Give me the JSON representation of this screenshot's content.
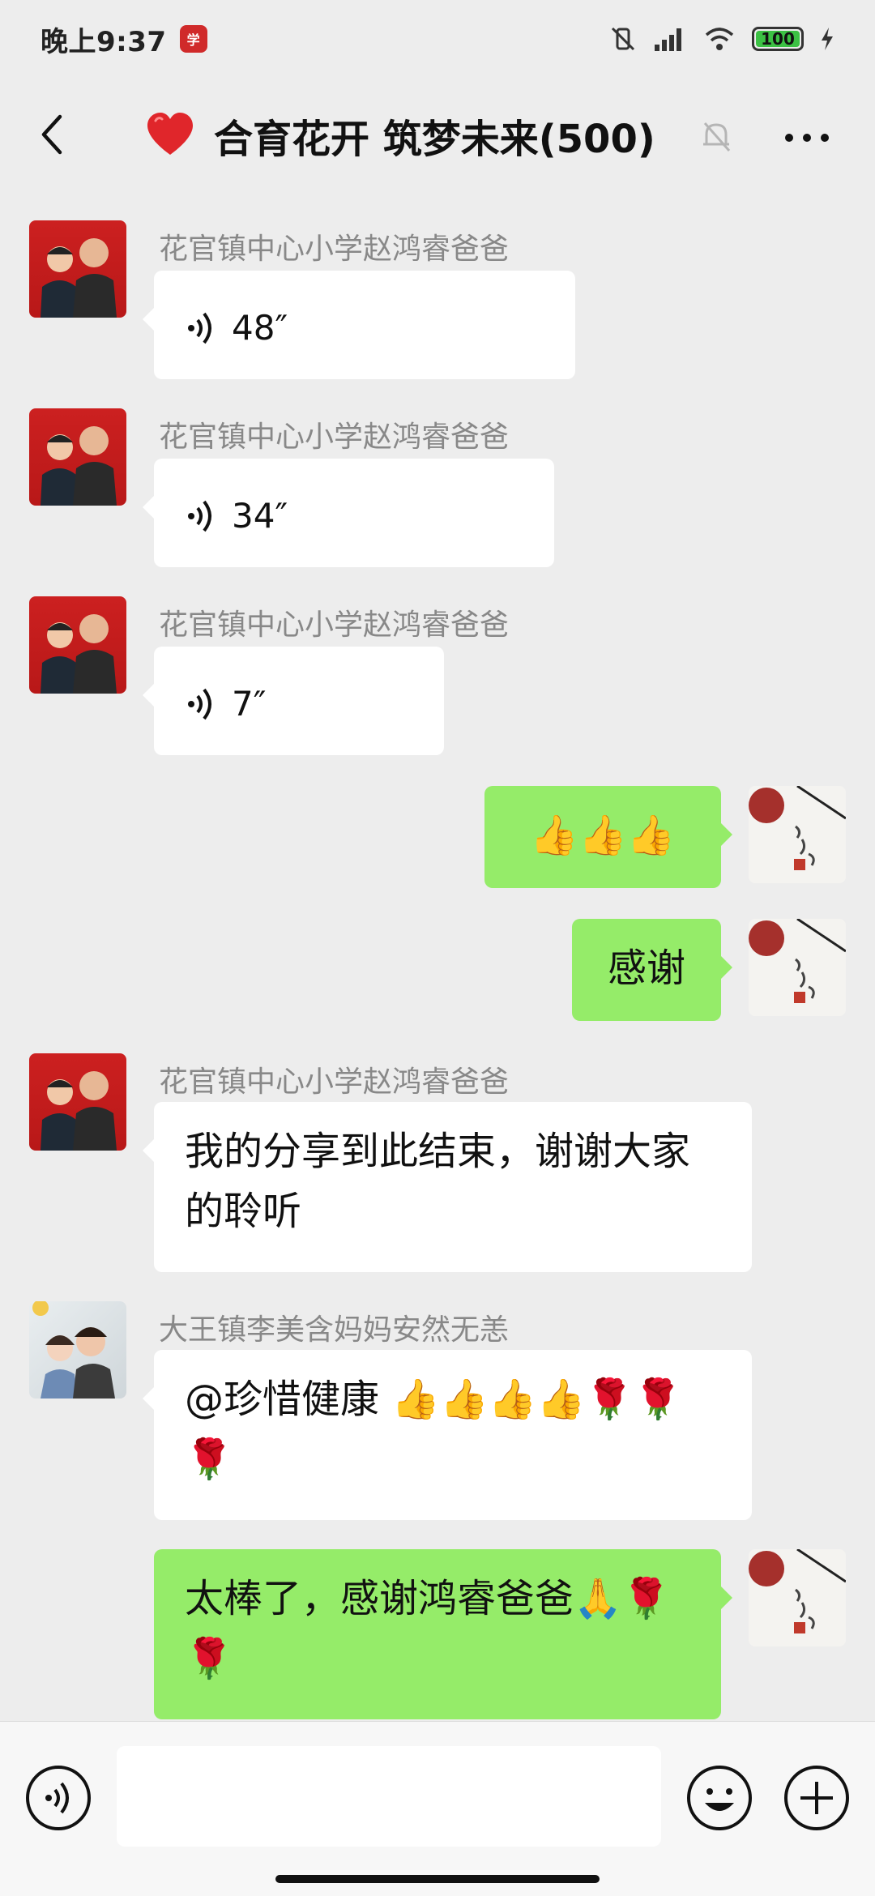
{
  "status": {
    "time": "晚上9:37",
    "battery": "100"
  },
  "chat": {
    "title": "合育花开 筑梦未来(500)",
    "icons": [
      "back-icon",
      "heart-icon",
      "mute-icon",
      "more-icon"
    ]
  },
  "messages": [
    {
      "sender": "花官镇中心小学赵鸿睿爸爸",
      "type": "voice",
      "duration": "48″"
    },
    {
      "sender": "花官镇中心小学赵鸿睿爸爸",
      "type": "voice",
      "duration": "34″"
    },
    {
      "sender": "花官镇中心小学赵鸿睿爸爸",
      "type": "voice",
      "duration": "7″"
    },
    {
      "sender": "",
      "type": "text",
      "text": "👍👍👍"
    },
    {
      "sender": "",
      "type": "text",
      "text": "感谢"
    },
    {
      "sender": "花官镇中心小学赵鸿睿爸爸",
      "type": "text",
      "text": "我的分享到此结束，谢谢大家的聆听"
    },
    {
      "sender": "大王镇李美含妈妈安然无恙",
      "type": "text",
      "text": "@珍惜健康 👍👍👍👍🌹🌹🌹"
    },
    {
      "sender": "",
      "type": "text",
      "text": "太棒了，感谢鸿睿爸爸🙏🌹🌹"
    }
  ],
  "input": {
    "placeholder": ""
  },
  "colors": {
    "background": "#ededed",
    "outgoing_bubble": "#95ec69",
    "incoming_bubble": "#ffffff",
    "sender_name": "#888888"
  }
}
